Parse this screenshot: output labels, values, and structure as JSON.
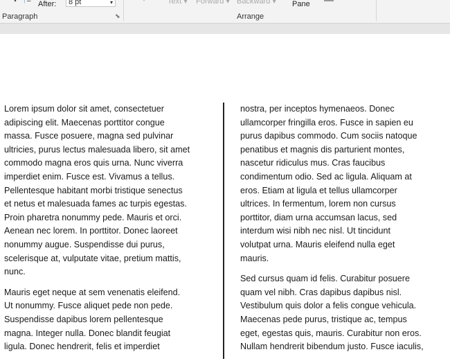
{
  "ribbon": {
    "paragraph_group": {
      "after_label": "After:",
      "after_value": "8 pt",
      "group_label": "Paragraph"
    },
    "arrange_group": {
      "items": [
        "Text",
        "Forward",
        "Backward",
        "Pane"
      ],
      "group_label": "Arrange"
    }
  },
  "document": {
    "left_column": [
      [
        "Lorem ipsum dolor sit amet, consectetuer",
        "adipiscing elit. Maecenas porttitor congue",
        "massa. Fusce posuere, magna sed pulvinar",
        "ultricies, purus lectus malesuada libero, sit amet",
        "commodo magna eros quis urna. Nunc viverra",
        "imperdiet enim. Fusce est. Vivamus a tellus.",
        "Pellentesque habitant morbi tristique senectus",
        "et netus et malesuada fames ac turpis egestas.",
        "Proin pharetra nonummy pede. Mauris et orci.",
        "Aenean nec lorem. In porttitor. Donec laoreet",
        "nonummy augue. Suspendisse dui purus,",
        "scelerisque at, vulputate vitae, pretium mattis,",
        "nunc."
      ],
      [
        "Mauris eget neque at sem venenatis eleifend.",
        "Ut nonummy. Fusce aliquet pede non pede.",
        "Suspendisse dapibus lorem pellentesque",
        "magna. Integer nulla. Donec blandit feugiat",
        "ligula. Donec hendrerit, felis et imperdiet"
      ]
    ],
    "right_column": [
      [
        "nostra, per inceptos hymenaeos. Donec",
        "ullamcorper fringilla eros. Fusce in sapien eu",
        "purus dapibus commodo. Cum sociis natoque",
        "penatibus et magnis dis parturient montes,",
        "nascetur ridiculus mus. Cras faucibus",
        "condimentum odio. Sed ac ligula. Aliquam at",
        "eros. Etiam at ligula et tellus ullamcorper",
        "ultrices. In fermentum, lorem non cursus",
        "porttitor, diam urna accumsan lacus, sed",
        "interdum wisi nibh nec nisl. Ut tincidunt",
        "volutpat urna. Mauris eleifend nulla eget",
        "mauris."
      ],
      [
        "Sed cursus quam id felis. Curabitur posuere",
        "quam vel nibh. Cras dapibus dapibus nisl.",
        "Vestibulum quis dolor a felis congue vehicula.",
        "Maecenas pede purus, tristique ac, tempus",
        "eget, egestas quis, mauris. Curabitur non eros.",
        "Nullam hendrerit bibendum justo. Fusce iaculis,"
      ]
    ]
  }
}
